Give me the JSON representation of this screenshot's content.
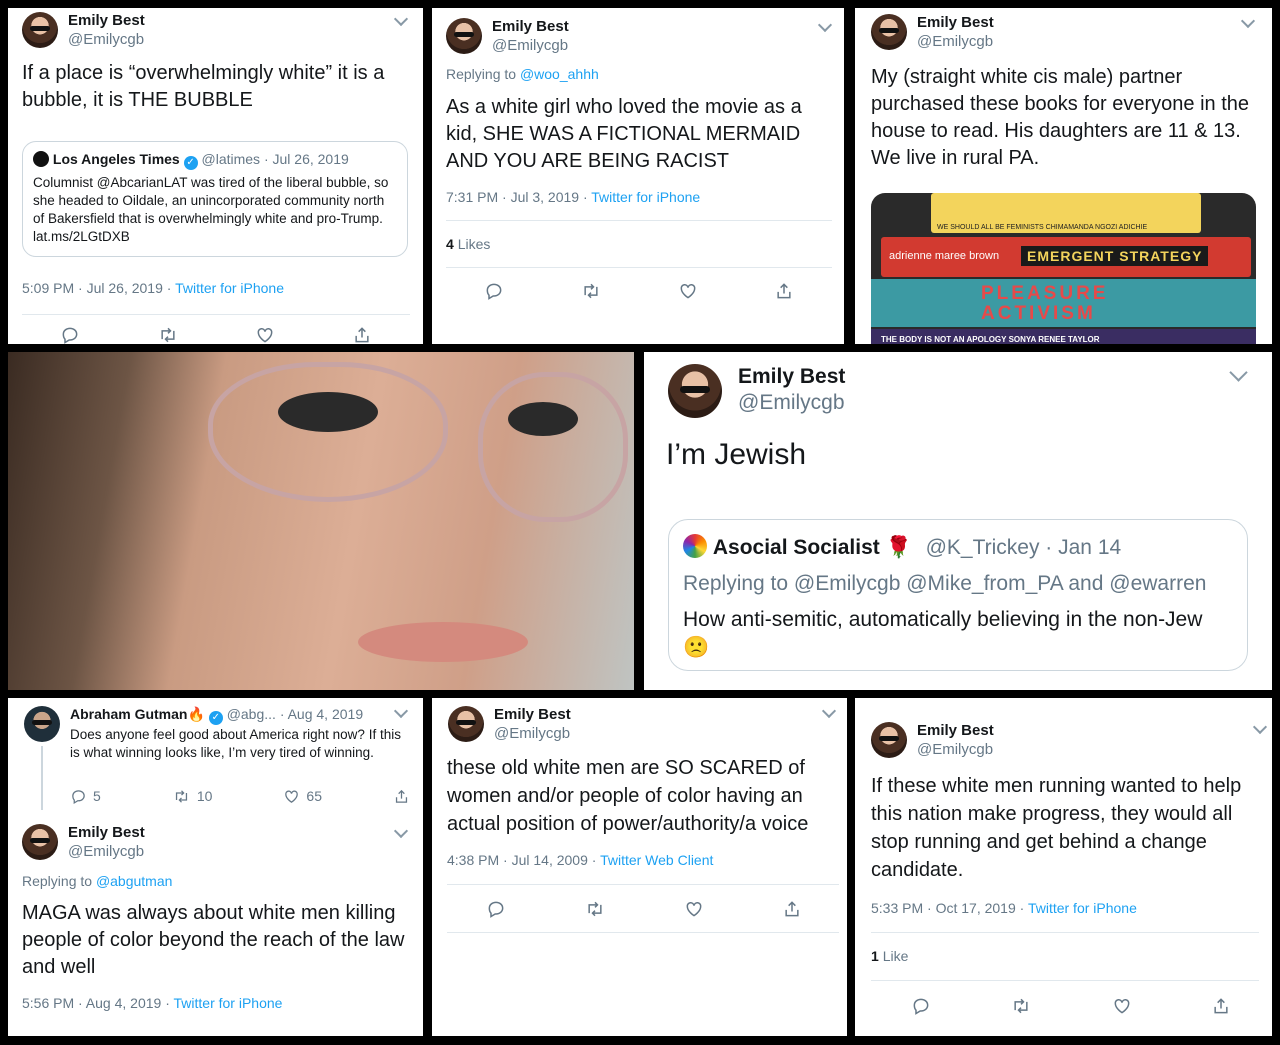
{
  "author": {
    "name": "Emily Best",
    "handle": "@Emilycgb"
  },
  "p1": {
    "text": "If a place is “overwhelmingly white” it is a bubble, it is THE BUBBLE",
    "quote": {
      "name": "Los Angeles Times",
      "handle_date": "@latimes · Jul 26, 2019",
      "text": "Columnist @AbcarianLAT was tired of the liberal bubble, so she headed to Oildale, an unincorporated community north of Bakersfield that is overwhelmingly white and pro-Trump. lat.ms/2LGtDXB"
    },
    "time": "5:09 PM · Jul 26, 2019 · ",
    "client": "Twitter for iPhone"
  },
  "p2": {
    "replying_prefix": "Replying to ",
    "replying_handle": "@woo_ahhh",
    "text": "As a white girl who loved the movie as a kid, SHE WAS A FICTIONAL MERMAID AND YOU ARE BEING RACIST",
    "time": "7:31 PM · Jul 3, 2019 · ",
    "client": "Twitter for iPhone",
    "likes_count": "4",
    "likes_label": "Likes"
  },
  "p3": {
    "text": "My (straight white cis male) partner purchased these books for everyone in the house to read. His daughters are 11 & 13. We live in rural PA.",
    "books": {
      "top_band": "WE SHOULD ALL BE FEMINISTS  CHIMAMANDA NGOZI ADICHIE",
      "author2": "adrienne maree brown",
      "title2": "EMERGENT STRATEGY",
      "title3a": "PLEASURE",
      "title3b": "ACTIVISM",
      "bottom": "THE BODY IS NOT AN APOLOGY  SONYA RENEE TAYLOR"
    }
  },
  "p5": {
    "text": "I’m Jewish",
    "quote": {
      "name": "Asocial Socialist 🌹",
      "handle_date": "@K_Trickey · Jan 14",
      "replying": "Replying to @Emilycgb @Mike_from_PA and @ewarren",
      "text": "How anti-semitic, automatically believing in the non-Jew 🙁"
    }
  },
  "p6": {
    "parent": {
      "name": "Abraham Gutman🔥",
      "handle_date": "@abg... · Aug 4, 2019",
      "text": "Does anyone feel good about America right now? If this is what winning looks like, I’m very tired of winning.",
      "replies": "5",
      "retweets": "10",
      "likes": "65"
    },
    "replying_prefix": "Replying to ",
    "replying_handle": "@abgutman",
    "text": "MAGA was always about white men killing people of color beyond the reach of the law and well",
    "time": "5:56 PM · Aug 4, 2019 · ",
    "client": "Twitter for iPhone"
  },
  "p7": {
    "text": "these old white men are SO SCARED of women and/or people of color having an actual position of power/authority/a voice",
    "time": "4:38 PM · Jul 14, 2009 · ",
    "client": "Twitter Web Client"
  },
  "p8": {
    "text": "If these white men running wanted to help this nation make progress, they would all stop running and get behind a change candidate.",
    "time": "5:33 PM · Oct 17, 2019 · ",
    "client": "Twitter for iPhone",
    "likes_count": "1",
    "likes_label": "Like"
  },
  "icons": [
    "reply-icon",
    "retweet-icon",
    "like-icon",
    "share-icon",
    "chevron-down-icon",
    "verified-badge-icon"
  ],
  "colors": {
    "link": "#1da1f2",
    "muted": "#657786",
    "divider": "#e1e8ed"
  }
}
